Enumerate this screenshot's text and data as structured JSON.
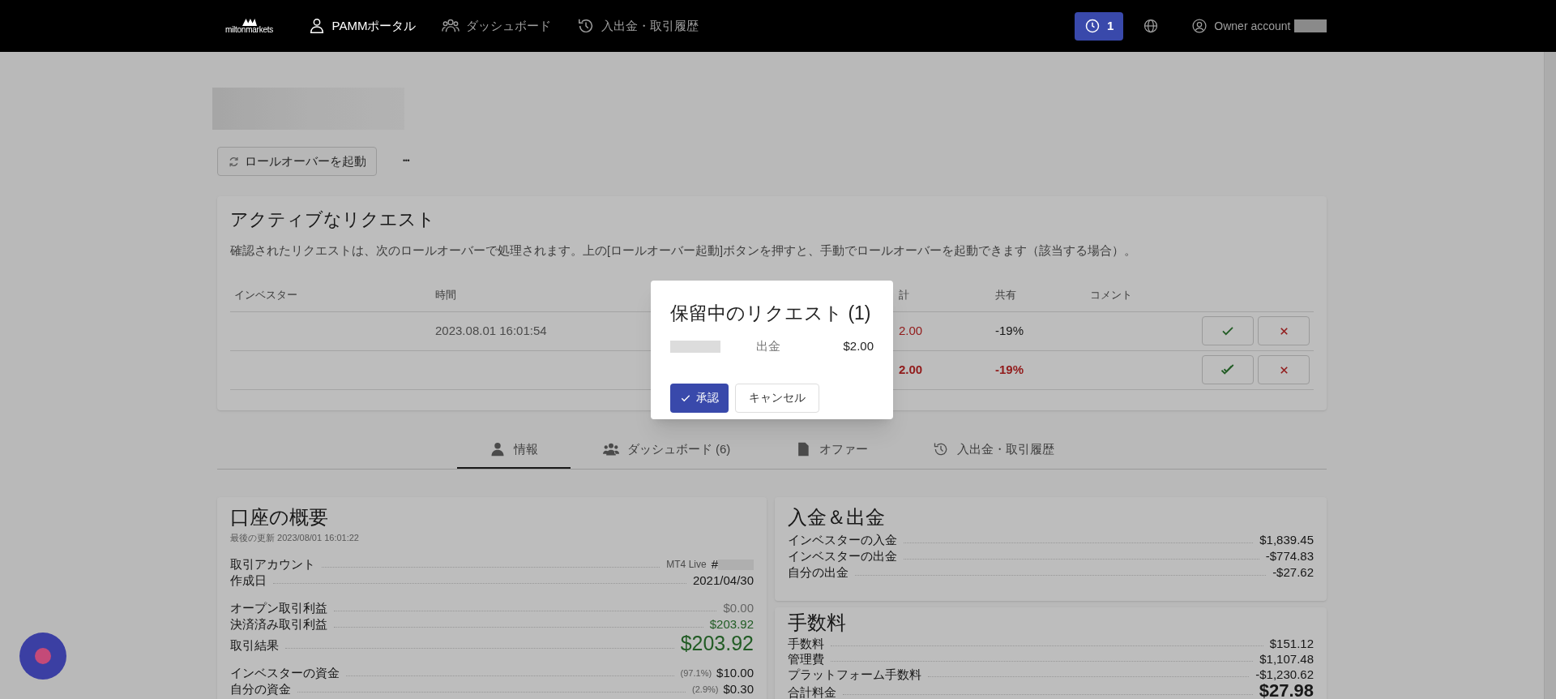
{
  "nav": {
    "logo": "miltonmarkets",
    "items": [
      {
        "label": "PAMMポータル",
        "selected": true
      },
      {
        "label": "ダッシュボード",
        "selected": false
      },
      {
        "label": "入出金・取引履歴",
        "selected": false
      }
    ],
    "notifications": "1",
    "account": "Owner account"
  },
  "toolbar": {
    "rollover_button": "ロールオーバーを起動",
    "more_button": "•••"
  },
  "active_requests": {
    "title": "アクティブなリクエスト",
    "description": "確認されたリクエストは、次のロールオーバーで処理されます。上の[ロールオーバー起動]ボタンを押すと、手動でロールオーバーを起動できます（該当する場合）。",
    "columns": [
      "インベスター",
      "時間",
      "計",
      "共有",
      "コメント"
    ],
    "rows": [
      {
        "time": "2023.08.01 16:01:54",
        "total": "2.00",
        "share": "-19%",
        "confirmed": false
      },
      {
        "time": "",
        "total": "2.00",
        "share": "-19%",
        "confirmed": true
      }
    ]
  },
  "tabs": [
    {
      "label": "情報",
      "selected": true
    },
    {
      "label": "ダッシュボード (6)",
      "selected": false
    },
    {
      "label": "オファー",
      "selected": false
    },
    {
      "label": "入出金・取引履歴",
      "selected": false
    }
  ],
  "overview": {
    "title": "口座の概要",
    "updated": "最後の更新 2023/08/01 16:01:22",
    "groups": [
      [
        {
          "label": "取引アカウント",
          "note": "MT4 Live",
          "value": "#",
          "kind": "account"
        },
        {
          "label": "作成日",
          "value": "2021/04/30",
          "kind": "plain"
        }
      ],
      [
        {
          "label": "オープン取引利益",
          "value": "$0.00",
          "kind": "muted"
        },
        {
          "label": "決済済み取引利益",
          "value": "$203.92",
          "kind": "positive"
        },
        {
          "label": "取引結果",
          "value": "$203.92",
          "kind": "big-positive"
        }
      ],
      [
        {
          "label": "インベスターの資金",
          "note": "(97.1%)",
          "value": "$10.00",
          "kind": "plain"
        },
        {
          "label": "自分の資金",
          "note": "(2.9%)",
          "value": "$0.30",
          "kind": "plain"
        }
      ]
    ]
  },
  "deposits": {
    "title": "入金＆出金",
    "rows": [
      {
        "label": "インベスターの入金",
        "value": "$1,839.45",
        "kind": "plain"
      },
      {
        "label": "インベスターの出金",
        "value": "-$774.83",
        "kind": "plain"
      },
      {
        "label": "自分の出金",
        "value": "-$27.62",
        "kind": "plain"
      }
    ]
  },
  "fees": {
    "title": "手数料",
    "rows": [
      {
        "label": "手数料",
        "value": "$151.12",
        "kind": "plain"
      },
      {
        "label": "管理費",
        "value": "$1,107.48",
        "kind": "plain"
      },
      {
        "label": "プラットフォーム手数料",
        "value": "-$1,230.62",
        "kind": "plain"
      },
      {
        "label": "合計料金",
        "value": "$27.98",
        "kind": "total"
      }
    ]
  },
  "modal": {
    "title": "保留中のリクエスト (1)",
    "type": "出金",
    "amount": "$2.00",
    "approve": "承認",
    "cancel": "キャンセル"
  }
}
